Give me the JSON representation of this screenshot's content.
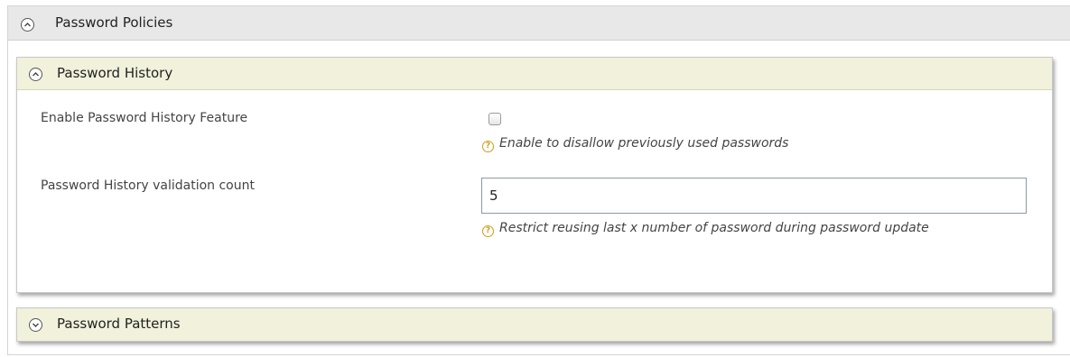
{
  "password_policies": {
    "title": "Password Policies",
    "password_history": {
      "title": "Password History",
      "enable_feature": {
        "label": "Enable Password History Feature",
        "checked": false,
        "help": "Enable to disallow previously used passwords"
      },
      "validation_count": {
        "label": "Password History validation count",
        "value": "5",
        "help": "Restrict reusing last x number of password during password update"
      }
    },
    "password_patterns": {
      "title": "Password Patterns"
    }
  },
  "colors": {
    "outer_header_bg": "#e8e8e8",
    "panel_header_bg": "#f1f1dc",
    "help_icon": "#d39b1a"
  },
  "icons": {
    "collapse": "chevron-up-icon",
    "expand": "chevron-down-icon",
    "help": "help-icon"
  }
}
